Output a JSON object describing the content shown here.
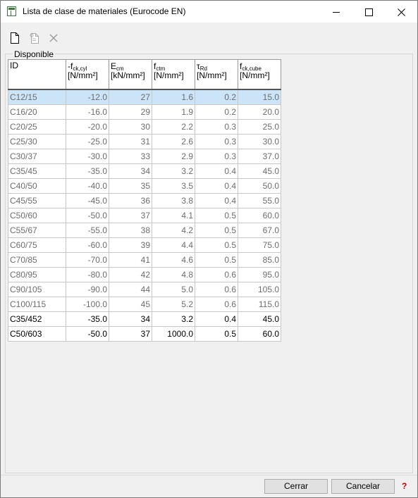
{
  "window": {
    "title": "Lista de clase de materiales (Eurocode EN)",
    "minimize": "—",
    "maximize": "☐",
    "close": "✕"
  },
  "toolbar": {
    "new_icon": "new-document-icon",
    "copy_icon": "copy-document-icon",
    "delete_icon": "delete-icon"
  },
  "group": {
    "label": "Disponible"
  },
  "table": {
    "columns": [
      {
        "id_label": "ID"
      },
      {
        "sym": "-f",
        "sub": "ck,cyl",
        "unit": "[N/mm²]"
      },
      {
        "sym": "E",
        "sub": "cm",
        "unit": "[kN/mm²]"
      },
      {
        "sym": "f",
        "sub": "ctm",
        "unit": "[N/mm²]"
      },
      {
        "sym": "τ",
        "sub": "Rd",
        "unit": "[N/mm²]"
      },
      {
        "sym": "f",
        "sub": "ck,cube",
        "unit": "[N/mm²]"
      }
    ],
    "rows": [
      {
        "id": "C12/15",
        "fck": "-12.0",
        "ecm": "27",
        "fctm": "1.6",
        "tau": "0.2",
        "fcube": "15.0"
      },
      {
        "id": "C16/20",
        "fck": "-16.0",
        "ecm": "29",
        "fctm": "1.9",
        "tau": "0.2",
        "fcube": "20.0"
      },
      {
        "id": "C20/25",
        "fck": "-20.0",
        "ecm": "30",
        "fctm": "2.2",
        "tau": "0.3",
        "fcube": "25.0"
      },
      {
        "id": "C25/30",
        "fck": "-25.0",
        "ecm": "31",
        "fctm": "2.6",
        "tau": "0.3",
        "fcube": "30.0"
      },
      {
        "id": "C30/37",
        "fck": "-30.0",
        "ecm": "33",
        "fctm": "2.9",
        "tau": "0.3",
        "fcube": "37.0"
      },
      {
        "id": "C35/45",
        "fck": "-35.0",
        "ecm": "34",
        "fctm": "3.2",
        "tau": "0.4",
        "fcube": "45.0"
      },
      {
        "id": "C40/50",
        "fck": "-40.0",
        "ecm": "35",
        "fctm": "3.5",
        "tau": "0.4",
        "fcube": "50.0"
      },
      {
        "id": "C45/55",
        "fck": "-45.0",
        "ecm": "36",
        "fctm": "3.8",
        "tau": "0.4",
        "fcube": "55.0"
      },
      {
        "id": "C50/60",
        "fck": "-50.0",
        "ecm": "37",
        "fctm": "4.1",
        "tau": "0.5",
        "fcube": "60.0"
      },
      {
        "id": "C55/67",
        "fck": "-55.0",
        "ecm": "38",
        "fctm": "4.2",
        "tau": "0.5",
        "fcube": "67.0"
      },
      {
        "id": "C60/75",
        "fck": "-60.0",
        "ecm": "39",
        "fctm": "4.4",
        "tau": "0.5",
        "fcube": "75.0"
      },
      {
        "id": "C70/85",
        "fck": "-70.0",
        "ecm": "41",
        "fctm": "4.6",
        "tau": "0.5",
        "fcube": "85.0"
      },
      {
        "id": "C80/95",
        "fck": "-80.0",
        "ecm": "42",
        "fctm": "4.8",
        "tau": "0.6",
        "fcube": "95.0"
      },
      {
        "id": "C90/105",
        "fck": "-90.0",
        "ecm": "44",
        "fctm": "5.0",
        "tau": "0.6",
        "fcube": "105.0"
      },
      {
        "id": "C100/115",
        "fck": "-100.0",
        "ecm": "45",
        "fctm": "5.2",
        "tau": "0.6",
        "fcube": "115.0"
      },
      {
        "id": "C35/452",
        "fck": "-35.0",
        "ecm": "34",
        "fctm": "3.2",
        "tau": "0.4",
        "fcube": "45.0"
      },
      {
        "id": "C50/603",
        "fck": "-50.0",
        "ecm": "37",
        "fctm": "1000.0",
        "tau": "0.5",
        "fcube": "60.0"
      }
    ]
  },
  "buttons": {
    "ok": "Cerrar",
    "cancel": "Cancelar",
    "help": "?"
  }
}
